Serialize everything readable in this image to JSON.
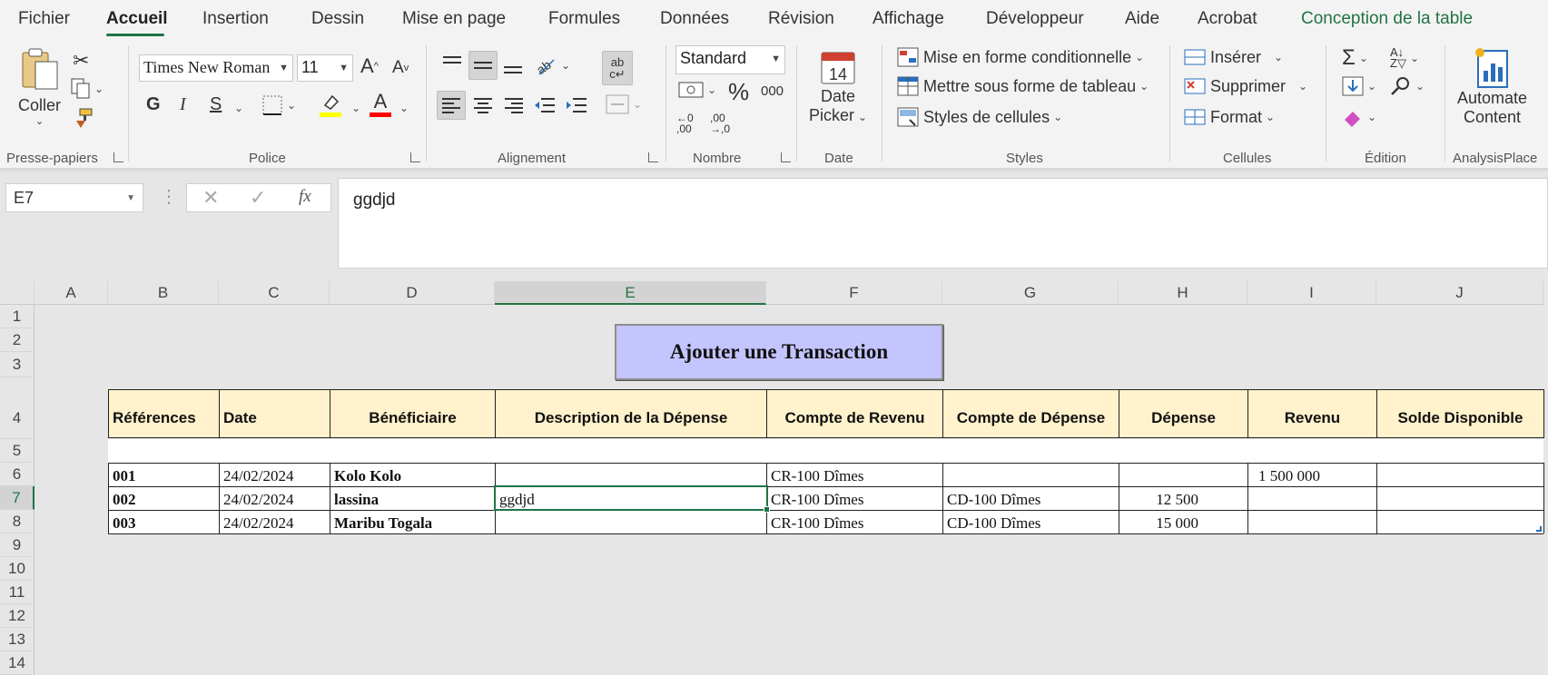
{
  "menu": {
    "tabs": [
      "Fichier",
      "Accueil",
      "Insertion",
      "Dessin",
      "Mise en page",
      "Formules",
      "Données",
      "Révision",
      "Affichage",
      "Développeur",
      "Aide",
      "Acrobat",
      "Conception de la table"
    ],
    "active": "Accueil"
  },
  "ribbon": {
    "clipboard": {
      "paste_label": "Coller",
      "group_label": "Presse-papiers"
    },
    "font": {
      "font_name": "Times New Roman",
      "font_size": "11",
      "bold": "G",
      "italic": "I",
      "underline": "S",
      "group_label": "Police",
      "highlight_color": "#ffff00",
      "font_color": "#ff0000"
    },
    "alignment": {
      "group_label": "Alignement"
    },
    "number": {
      "format": "Standard",
      "percent": "%",
      "thousands": "000",
      "group_label": "Nombre"
    },
    "date": {
      "day": "14",
      "label1": "Date",
      "label2": "Picker",
      "group_label": "Date"
    },
    "styles": {
      "conditional": "Mise en forme conditionnelle",
      "as_table": "Mettre sous forme de tableau",
      "cell_styles": "Styles de cellules",
      "group_label": "Styles"
    },
    "cells": {
      "insert": "Insérer",
      "delete": "Supprimer",
      "format": "Format",
      "group_label": "Cellules"
    },
    "editing": {
      "group_label": "Édition"
    },
    "analysis": {
      "label1": "Automate",
      "label2": "Content",
      "group_label": "AnalysisPlace"
    }
  },
  "formula_bar": {
    "name_box": "E7",
    "fx": "fx",
    "value": "ggdjd"
  },
  "grid": {
    "columns": [
      "A",
      "B",
      "C",
      "D",
      "E",
      "F",
      "G",
      "H",
      "I",
      "J"
    ],
    "rows": [
      "1",
      "2",
      "3",
      "4",
      "5",
      "6",
      "7",
      "8",
      "9",
      "10",
      "11",
      "12",
      "13",
      "14"
    ],
    "selected_cell": "E7"
  },
  "sheet": {
    "button_label": "Ajouter une Transaction",
    "headers": [
      "Références",
      "Date",
      "Bénéficiaire",
      "Description de la Dépense",
      "Compte de Revenu",
      "Compte de Dépense",
      "Dépense",
      "Revenu",
      "Solde Disponible"
    ],
    "rows": [
      [
        "001",
        "24/02/2024",
        "Kolo Kolo",
        "",
        "CR-100 Dîmes",
        "",
        "",
        "1 500 000",
        ""
      ],
      [
        "002",
        "24/02/2024",
        "lassina",
        "ggdjd",
        "CR-100 Dîmes",
        "CD-100 Dîmes",
        "12 500",
        "",
        ""
      ],
      [
        "003",
        "24/02/2024",
        "Maribu Togala",
        "",
        "CR-100 Dîmes",
        "CD-100 Dîmes",
        "15 000",
        "",
        ""
      ]
    ]
  },
  "colors": {
    "accent": "#217346",
    "header_fill": "#fff2cc",
    "button_fill": "#c4c4ff"
  }
}
